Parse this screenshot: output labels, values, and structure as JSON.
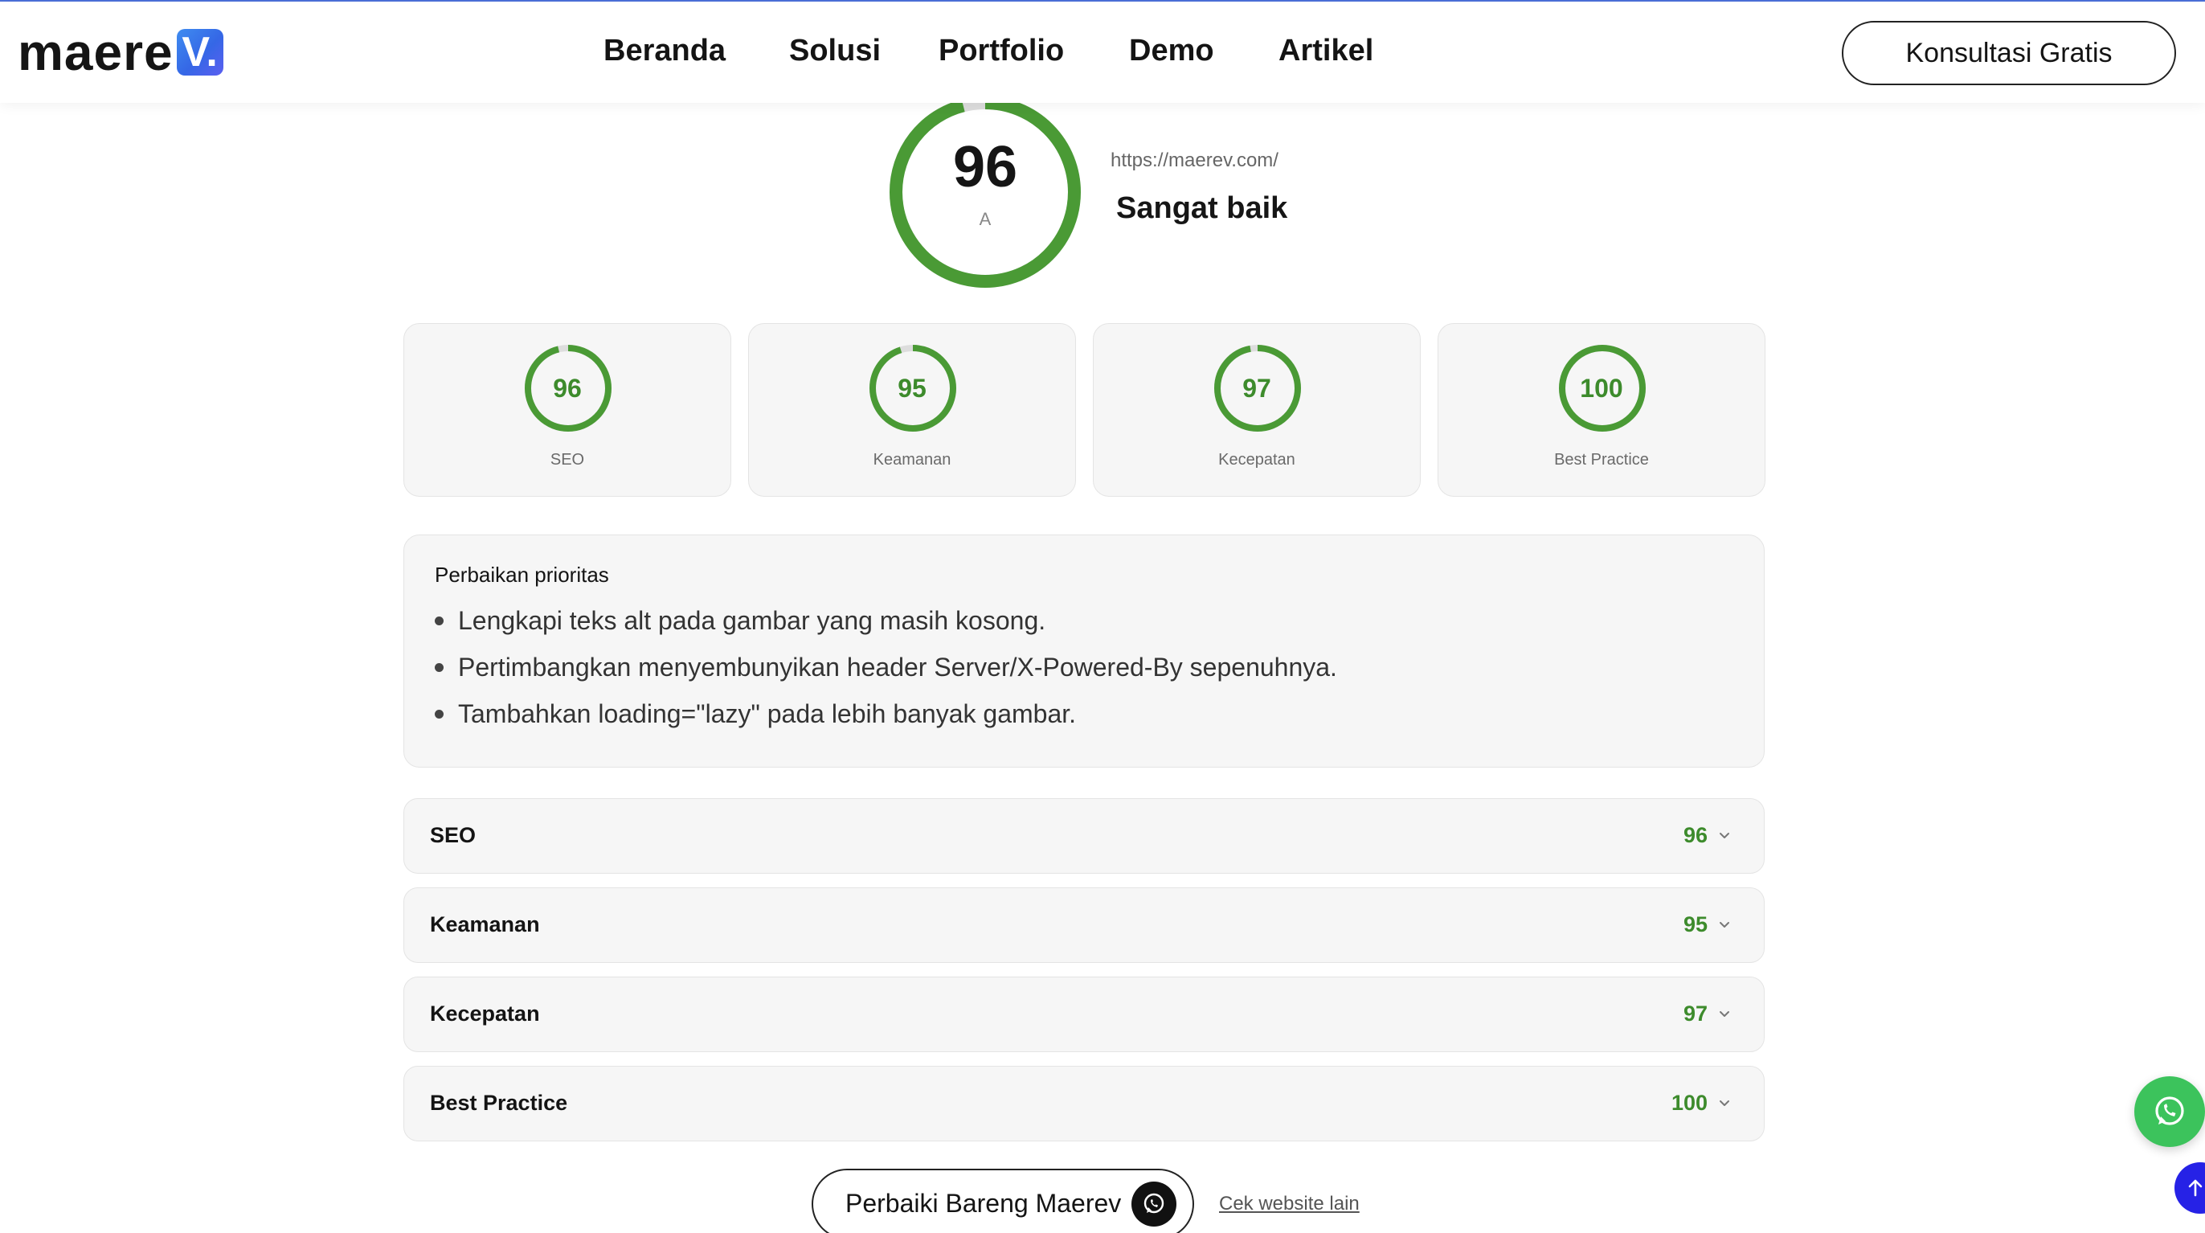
{
  "header": {
    "logo": {
      "text": "maere",
      "badge": "V."
    },
    "nav": [
      {
        "label": "Beranda"
      },
      {
        "label": "Solusi"
      },
      {
        "label": "Portfolio"
      },
      {
        "label": "Demo"
      },
      {
        "label": "Artikel"
      }
    ],
    "cta_label": "Konsultasi Gratis"
  },
  "hero": {
    "score": "96",
    "score_value": 96,
    "grade": "A",
    "url": "https://maerev.com/",
    "verdict": "Sangat baik"
  },
  "cards": [
    {
      "label": "SEO",
      "score": "96",
      "value": 96
    },
    {
      "label": "Keamanan",
      "score": "95",
      "value": 95
    },
    {
      "label": "Kecepatan",
      "score": "97",
      "value": 97
    },
    {
      "label": "Best Practice",
      "score": "100",
      "value": 100
    }
  ],
  "priority": {
    "title": "Perbaikan prioritas",
    "items": [
      "Lengkapi teks alt pada gambar yang masih kosong.",
      "Pertimbangkan menyembunyikan header Server/X-Powered-By sepenuhnya.",
      "Tambahkan loading=\"lazy\" pada lebih banyak gambar."
    ]
  },
  "sections": [
    {
      "label": "SEO",
      "score": "96"
    },
    {
      "label": "Keamanan",
      "score": "95"
    },
    {
      "label": "Kecepatan",
      "score": "97"
    },
    {
      "label": "Best Practice",
      "score": "100"
    }
  ],
  "actions": {
    "fix_label": "Perbaiki Bareng Maerev",
    "check_label": "Cek website lain"
  },
  "colors": {
    "accent_green": "#3d8b2c",
    "ring_green": "#4a9a35",
    "ring_track": "#dddddd",
    "whatsapp_green": "#3cc35c",
    "scroll_top_blue": "#2622e6"
  },
  "icons": {
    "whatsapp": "whatsapp-icon",
    "chevron": "chevron-down-icon",
    "arrow_up": "arrow-up-icon"
  }
}
